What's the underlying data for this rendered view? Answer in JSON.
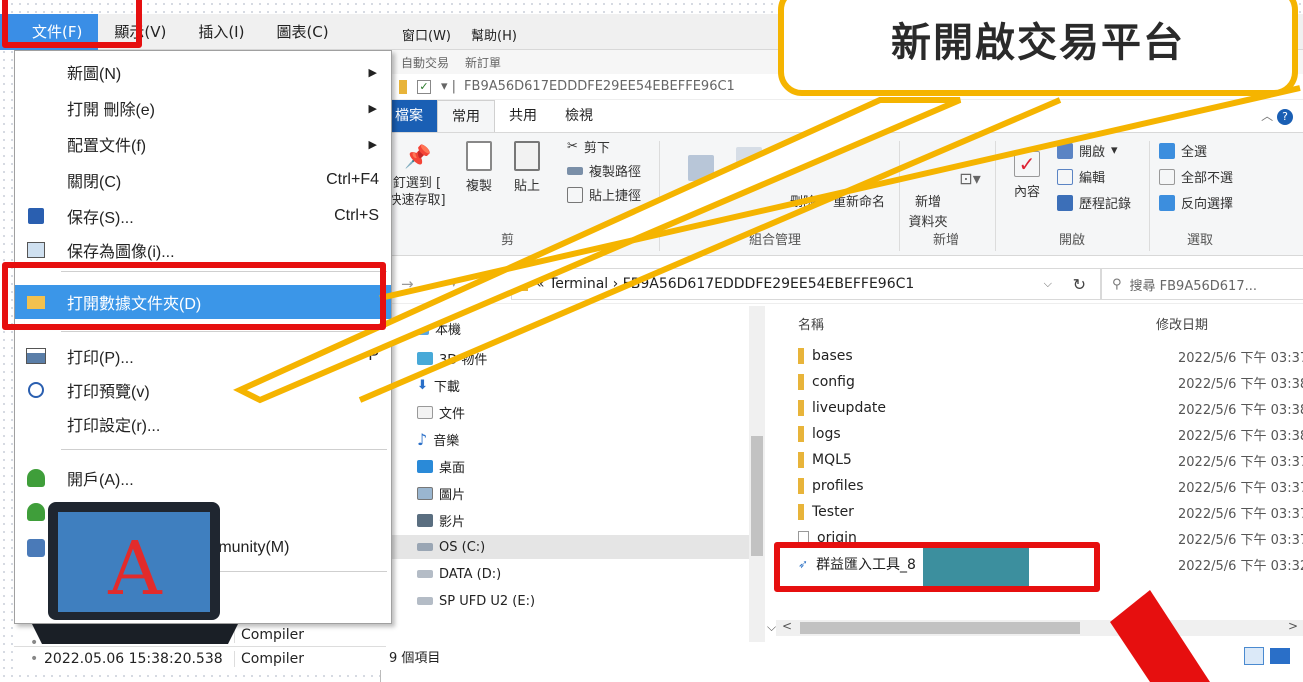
{
  "mt_menubar": {
    "items": [
      "文件(F)",
      "顯示(V)",
      "插入(I)",
      "圖表(C)"
    ]
  },
  "small_menubar": {
    "items": [
      "窗口(W)",
      "幫助(H)"
    ]
  },
  "explorer": {
    "toolbar_row": [
      "自動交易",
      "新訂單"
    ],
    "title_path": "FB9A56D617EDDDFE29EE54EBEFFE96C1",
    "tabs": [
      "檔案",
      "常用",
      "共用",
      "檢視"
    ],
    "ribbon": {
      "pin": "釘選到 [\n快速存取]",
      "copy": "複製",
      "paste": "貼上",
      "cut": "剪下",
      "copy_path": "複製路徑",
      "paste_shortcut": "貼上捷徑",
      "delete": "刪除",
      "rename": "重新命名",
      "new_folder": "新增\n資料夾",
      "properties": "內容",
      "open": "開啟",
      "edit": "編輯",
      "history": "歷程記錄",
      "select_all": "全選",
      "select_none": "全部不選",
      "invert": "反向選擇",
      "groups": [
        "剪",
        "組合管理",
        "新增",
        "開啟",
        "選取"
      ]
    },
    "address": {
      "path": "«  Terminal  ›  FB9A56D617EDDDFE29EE54EBEFFE96C1",
      "search_placeholder": "搜尋 FB9A56D617..."
    },
    "nav": [
      "本機",
      "3D 物件",
      "下載",
      "文件",
      "音樂",
      "桌面",
      "圖片",
      "影片",
      "OS (C:)",
      "DATA (D:)",
      "SP UFD U2 (E:)"
    ],
    "columns": {
      "name": "名稱",
      "modified": "修改日期"
    },
    "files": [
      {
        "name": "bases",
        "date": "2022/5/6 下午 03:37"
      },
      {
        "name": "config",
        "date": "2022/5/6 下午 03:38"
      },
      {
        "name": "liveupdate",
        "date": "2022/5/6 下午 03:38"
      },
      {
        "name": "logs",
        "date": "2022/5/6 下午 03:38"
      },
      {
        "name": "MQL5",
        "date": "2022/5/6 下午 03:37"
      },
      {
        "name": "profiles",
        "date": "2022/5/6 下午 03:37"
      },
      {
        "name": "Tester",
        "date": "2022/5/6 下午 03:37"
      },
      {
        "name": "origin",
        "date": "2022/5/6 下午 03:37"
      },
      {
        "name": "群益匯入工具_8",
        "date": "2022/5/6 下午 03:32"
      }
    ],
    "status": "9 個項目"
  },
  "file_menu": {
    "items": [
      {
        "label": "新圖(N)",
        "shortcut": "",
        "submenu": true
      },
      {
        "label": "打開 刪除(e)",
        "shortcut": "",
        "submenu": true
      },
      {
        "label": "配置文件(f)",
        "shortcut": "",
        "submenu": true
      },
      {
        "label": "關閉(C)",
        "shortcut": "Ctrl+F4",
        "submenu": false
      },
      {
        "label": "保存(S)...",
        "shortcut": "Ctrl+S",
        "submenu": false
      },
      {
        "label": "保存為圖像(i)...",
        "shortcut": "",
        "submenu": false
      },
      {
        "label": "打開數據文件夾(D)",
        "shortcut": "",
        "submenu": false
      },
      {
        "label": "打印(P)...",
        "shortcut": "Ctrl+P",
        "submenu": false
      },
      {
        "label": "打印預覽(v)",
        "shortcut": "",
        "submenu": false
      },
      {
        "label": "打印設定(r)...",
        "shortcut": "",
        "submenu": false
      },
      {
        "label": "開戶(A)...",
        "shortcut": "",
        "submenu": false
      },
      {
        "label": ")",
        "shortcut": "",
        "submenu": false
      },
      {
        "label": "mmunity(M)",
        "shortcut": "",
        "submenu": false
      }
    ]
  },
  "journal": [
    {
      "time": "",
      "source": "Compiler"
    },
    {
      "time": "2022.05.06 15:38:20.538",
      "source": "Compiler"
    }
  ],
  "callout": {
    "text": "新開啟交易平台"
  },
  "laptop_letter": "A",
  "colors": {
    "highlight": "#e60f0f",
    "callout_border": "#f5b400",
    "menu_select": "#3b96e8"
  }
}
